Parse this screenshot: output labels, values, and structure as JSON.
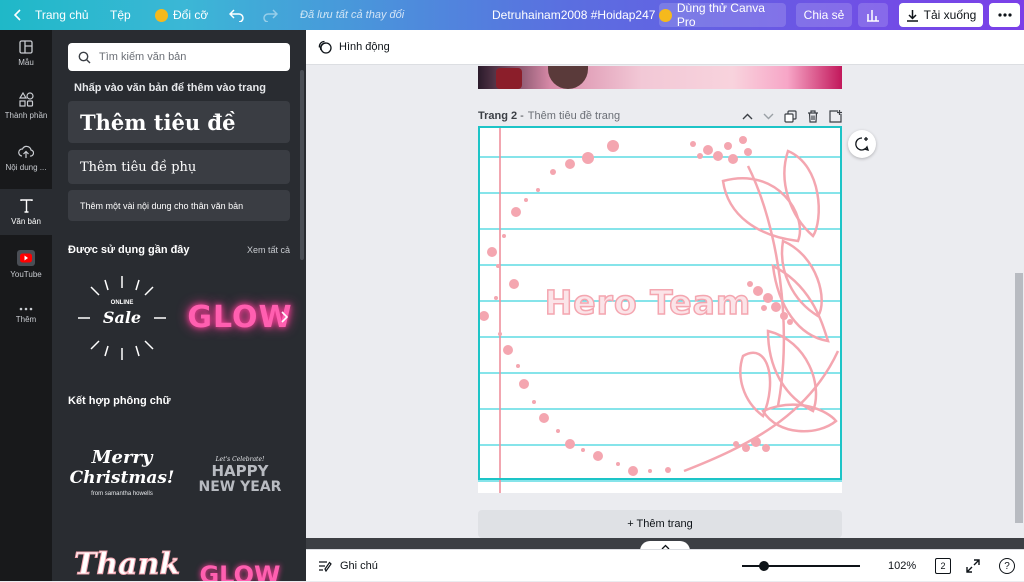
{
  "topbar": {
    "home": "Trang chủ",
    "file": "Tệp",
    "resize": "Đổi cỡ",
    "saved": "Đã lưu tất cả thay đổi",
    "doc_title": "Detruhainam2008 #Hoidap247",
    "try_pro": "Dùng thử Canva Pro",
    "share": "Chia sẻ",
    "download": "Tải xuống"
  },
  "rail": {
    "items": [
      {
        "label": "Mẫu",
        "icon": "template-icon"
      },
      {
        "label": "Thành phần",
        "icon": "elements-icon"
      },
      {
        "label": "Nội dung ...",
        "icon": "upload-icon"
      },
      {
        "label": "Văn bản",
        "icon": "text-icon"
      },
      {
        "label": "YouTube",
        "icon": "youtube-icon"
      },
      {
        "label": "Thêm",
        "icon": "more-icon"
      }
    ]
  },
  "panel": {
    "search_placeholder": "Tìm kiếm văn bản",
    "hint": "Nhấp vào văn bản để thêm vào trang",
    "add_heading": "Thêm tiêu đề",
    "add_subheading": "Thêm tiêu đề phụ",
    "add_body": "Thêm một vài nội dung cho thân văn bản",
    "recent_title": "Được sử dụng gần đây",
    "see_all": "Xem tất cả",
    "combo_title": "Kết hợp phông chữ",
    "thumbs": {
      "sale_online": "ONLINE",
      "sale": "Sale",
      "glow": "GLOW",
      "merry": "Merry",
      "christmas": "Christmas!",
      "from": "from samantha howells",
      "celebrate": "Let's Celebrate!",
      "happy": "HAPPY",
      "new_year": "NEW YEAR",
      "thank": "Thank",
      "glow2": "GLOW"
    }
  },
  "editor": {
    "toolbar_animate": "Hình động",
    "page_label": "Trang 2",
    "page_title_placeholder": "Thêm tiêu đề trang",
    "canvas_text": "Hero Team",
    "add_page": "+ Thêm trang"
  },
  "bottombar": {
    "notes": "Ghi chú",
    "zoom": "102%",
    "pages": "2",
    "help": "?"
  },
  "colors": {
    "accent_teal": "#1dc4c7",
    "pink": "#f4a6b0",
    "glow_pink": "#ff3d9a"
  }
}
